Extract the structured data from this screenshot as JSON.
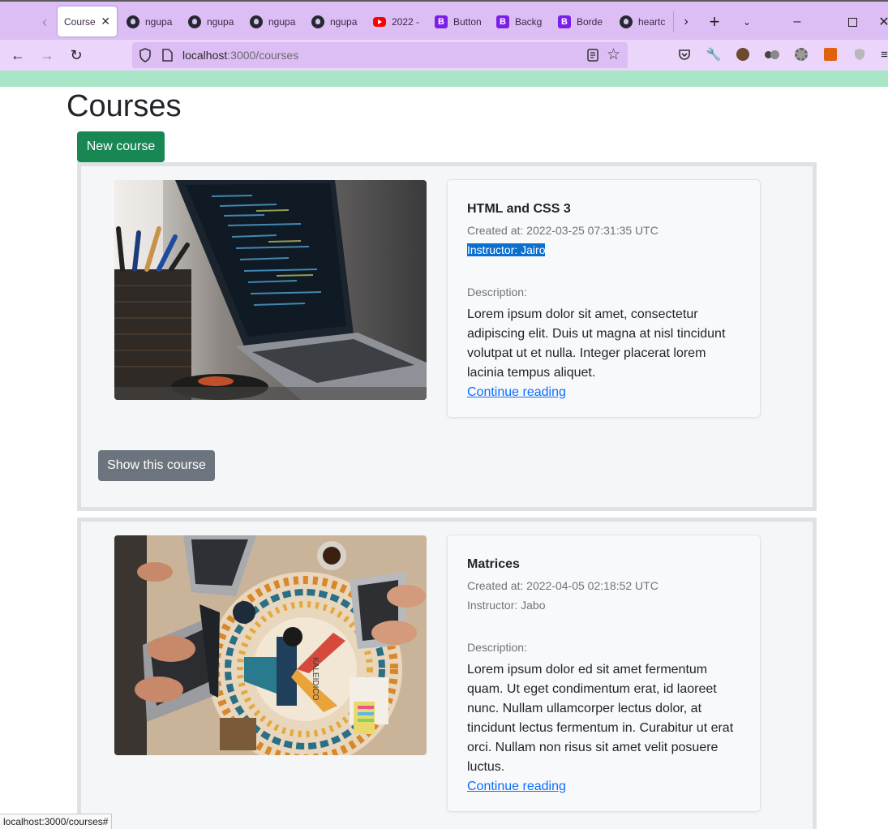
{
  "browser": {
    "tabs": [
      {
        "label": "Courses",
        "icon": "app-icon",
        "active": true
      },
      {
        "label": "ngupa",
        "icon": "github-icon"
      },
      {
        "label": "ngupa",
        "icon": "github-icon"
      },
      {
        "label": "ngupa",
        "icon": "github-icon"
      },
      {
        "label": "ngupa",
        "icon": "github-icon"
      },
      {
        "label": "2022 -",
        "icon": "youtube-icon"
      },
      {
        "label": "Button",
        "icon": "bootstrap-icon"
      },
      {
        "label": "Backg",
        "icon": "bootstrap-icon"
      },
      {
        "label": "Borde",
        "icon": "bootstrap-icon"
      },
      {
        "label": "heartc",
        "icon": "github-icon"
      }
    ],
    "url_host": "localhost",
    "url_rest": ":3000/courses",
    "status_url": "localhost:3000/courses#",
    "colors": {
      "tabbar": "#dcbdf4",
      "toolbar": "#ebd5fb",
      "strip": "#a8e6c7"
    }
  },
  "page": {
    "title": "Courses",
    "new_button": "New course"
  },
  "courses": [
    {
      "title": "HTML and CSS 3",
      "created": "Created at: 2022-03-25 07:31:35 UTC",
      "instructor": "Instructor: Jairo",
      "desc_label": "Description:",
      "desc": "Lorem ipsum dolor sit amet, consectetur adipiscing elit. Duis ut magna at nisl tincidunt volutpat ut et nulla. Integer placerat lorem lacinia tempus aliquet.",
      "link": "Continue reading",
      "show_button": "Show this course",
      "image": "laptop-code-photo"
    },
    {
      "title": "Matrices",
      "created": "Created at: 2022-04-05 02:18:52 UTC",
      "instructor": "Instructor: Jabo",
      "desc_label": "Description:",
      "desc": "Lorem ipsum dolor ed sit amet fermentum quam. Ut eget condimentum erat, id laoreet nunc. Nullam ullamcorper lectus dolor, at tincidunt lectus fermentum in. Curabitur ut erat orci. Nullam non risus sit amet velit posuere luctus.",
      "link": "Continue reading",
      "image": "kaleidico-desk-photo",
      "image_caption": "KALEIDICO"
    }
  ]
}
